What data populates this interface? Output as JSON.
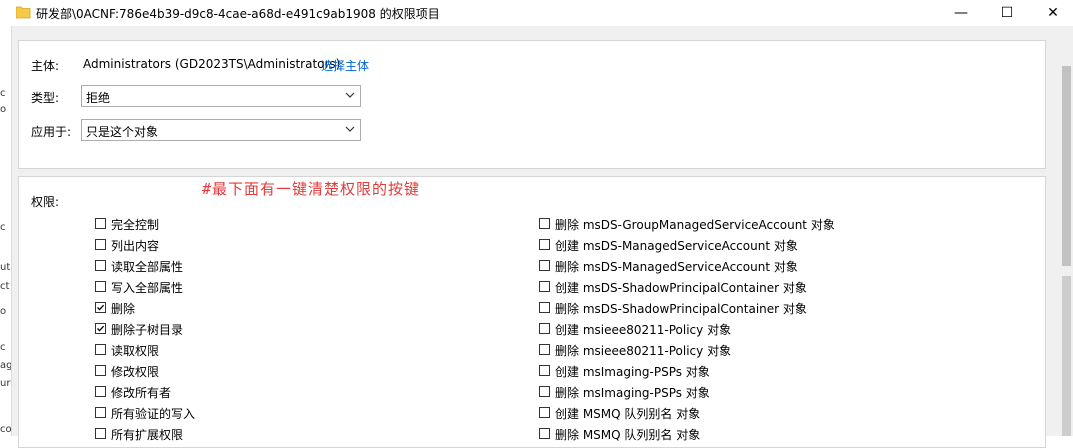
{
  "window": {
    "title": "研发部\\0ACNF:786e4b39-d9c8-4cae-a68d-e491c9ab1908 的权限项目",
    "minimize_glyph": "—",
    "maximize_glyph": "☐",
    "close_glyph": "✕"
  },
  "left_strip": [
    "c",
    "o",
    "c",
    "ut",
    "ct",
    "o",
    "c",
    "ag",
    "ur",
    "co"
  ],
  "principal": {
    "label": "主体:",
    "value": "Administrators (GD2023TS\\Administrators)",
    "select_link": "选择主体"
  },
  "type": {
    "label": "类型:",
    "value": "拒绝"
  },
  "applies_to": {
    "label": "应用于:",
    "value": "只是这个对象"
  },
  "permissions": {
    "label": "权限:",
    "annotation": "#最下面有一键清楚权限的按键",
    "left": [
      {
        "label": "完全控制",
        "checked": false
      },
      {
        "label": "列出内容",
        "checked": false
      },
      {
        "label": "读取全部属性",
        "checked": false
      },
      {
        "label": "写入全部属性",
        "checked": false
      },
      {
        "label": "删除",
        "checked": true
      },
      {
        "label": "删除子树目录",
        "checked": true
      },
      {
        "label": "读取权限",
        "checked": false
      },
      {
        "label": "修改权限",
        "checked": false
      },
      {
        "label": "修改所有者",
        "checked": false
      },
      {
        "label": "所有验证的写入",
        "checked": false
      },
      {
        "label": "所有扩展权限",
        "checked": false
      }
    ],
    "right": [
      {
        "label": "删除 msDS-GroupManagedServiceAccount 对象",
        "checked": false
      },
      {
        "label": "创建 msDS-ManagedServiceAccount 对象",
        "checked": false
      },
      {
        "label": "删除 msDS-ManagedServiceAccount 对象",
        "checked": false
      },
      {
        "label": "创建 msDS-ShadowPrincipalContainer 对象",
        "checked": false
      },
      {
        "label": "删除 msDS-ShadowPrincipalContainer 对象",
        "checked": false
      },
      {
        "label": "创建 msieee80211-Policy 对象",
        "checked": false
      },
      {
        "label": "删除 msieee80211-Policy 对象",
        "checked": false
      },
      {
        "label": "创建 msImaging-PSPs 对象",
        "checked": false
      },
      {
        "label": "删除 msImaging-PSPs 对象",
        "checked": false
      },
      {
        "label": "创建 MSMQ 队列别名 对象",
        "checked": false
      },
      {
        "label": "删除 MSMQ 队列别名 对象",
        "checked": false
      }
    ]
  }
}
